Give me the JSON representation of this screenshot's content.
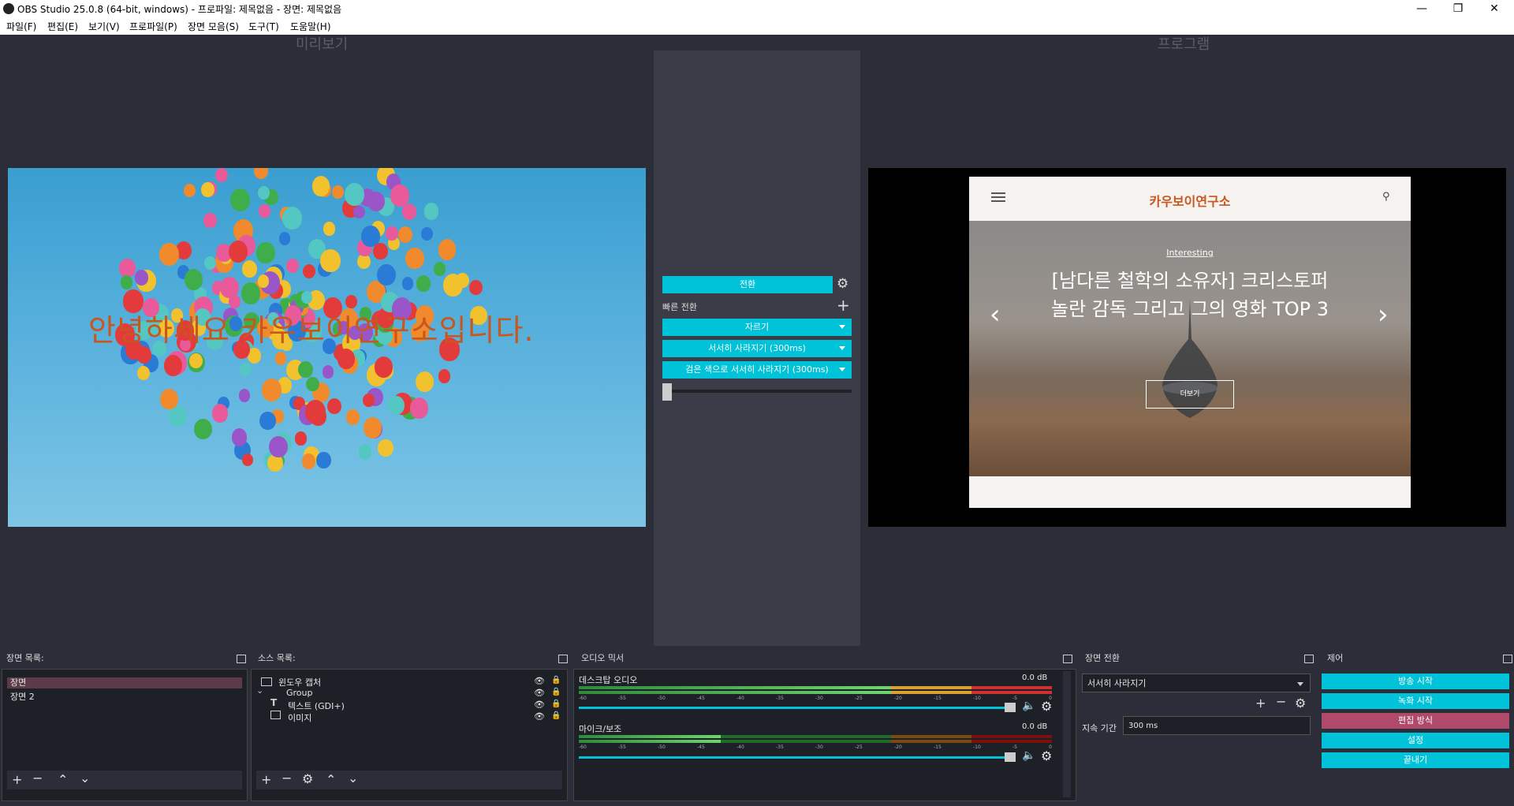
{
  "window": {
    "title": "OBS Studio 25.0.8 (64-bit, windows) - 프로파일: 제목없음 - 장면: 제목없음",
    "minimize": "—",
    "maximize": "❐",
    "close": "✕"
  },
  "menu": [
    "파일(F)",
    "편집(E)",
    "보기(V)",
    "프로파일(P)",
    "장면 모음(S)",
    "도구(T)",
    "도움말(H)"
  ],
  "preview": {
    "label": "미리보기",
    "overlay_text": "안녕하세요 카우보이연구소입니다."
  },
  "program": {
    "label": "프로그램",
    "site_title": "카우보이연구소",
    "category": "Interesting",
    "headline_line1": "[남다른 철학의 소유자] 크리스토퍼",
    "headline_line2": "놀란 감독 그리고 그의 영화 TOP 3",
    "more_button": "더보기",
    "prev_arrow": "‹",
    "next_arrow": "›"
  },
  "transition_controls": {
    "transition_button": "전환",
    "quick_transitions_label": "빠른 전환",
    "cut": "자르기",
    "fade": "서서히 사라지기 (300ms)",
    "fade_to_black": "검은 색으로 서서히 사라지기 (300ms)",
    "tbar_value": 0
  },
  "docks": {
    "scenes": {
      "header": "장면 목록:",
      "items": [
        "장면",
        "장면 2"
      ],
      "selected_index": 0
    },
    "sources": {
      "header": "소스 목록:",
      "items": [
        {
          "label": "윈도우 캡처",
          "indent": 0,
          "icon": "window-icon"
        },
        {
          "label": "Group",
          "indent": 0,
          "icon": "chevron-down-icon"
        },
        {
          "label": "텍스트 (GDI+)",
          "indent": 1,
          "icon": "text-icon"
        },
        {
          "label": "이미지",
          "indent": 1,
          "icon": "image-icon"
        }
      ]
    },
    "mixer": {
      "header": "오디오 믹서",
      "channels": [
        {
          "name": "데스크탑 오디오",
          "level": "0.0 dB",
          "volume": 1.0
        },
        {
          "name": "마이크/보조",
          "level": "0.0 dB",
          "volume": 1.0
        }
      ],
      "scale": [
        "-60",
        "-55",
        "-50",
        "-45",
        "-40",
        "-35",
        "-30",
        "-25",
        "-20",
        "-15",
        "-10",
        "-5",
        "0"
      ]
    },
    "scene_transitions": {
      "header": "장면 전환",
      "selected": "서서히 사라지기",
      "duration_label": "지속 기간",
      "duration_value": "300 ms"
    },
    "controls": {
      "header": "제어",
      "start_streaming": "방송 시작",
      "start_recording": "녹화 시작",
      "studio_mode": "편집 방식",
      "settings": "설정",
      "exit": "끝내기"
    }
  },
  "colors": {
    "accent": "#00c2d8",
    "studio_mode_active": "#b04a6a",
    "selected_scene": "#5c3a48",
    "overlay_text": "#c8561d",
    "site_title": "#c8561d"
  }
}
